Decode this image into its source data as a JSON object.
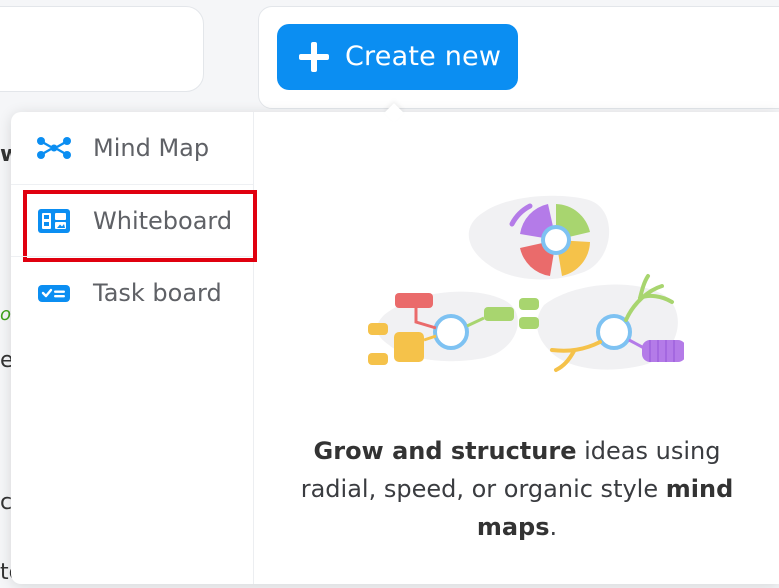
{
  "header": {
    "create_button_label": "Create new"
  },
  "background_fragments": {
    "frag_1": "w",
    "frag_2": "o",
    "frag_3": "e",
    "frag_4": "c",
    "frag_5": "tc"
  },
  "dropdown": {
    "items": [
      {
        "label": "Mind Map",
        "icon": "mind-map-icon"
      },
      {
        "label": "Whiteboard",
        "icon": "whiteboard-icon",
        "highlighted": true
      },
      {
        "label": "Task board",
        "icon": "task-board-icon"
      }
    ],
    "preview": {
      "desc_bold_1": "Grow and structure",
      "desc_text_1": " ideas using radial, speed, or organic style ",
      "desc_bold_2": "mind maps",
      "desc_text_2": "."
    }
  },
  "colors": {
    "accent": "#0b8ef2",
    "highlight_border": "#e0000f"
  }
}
